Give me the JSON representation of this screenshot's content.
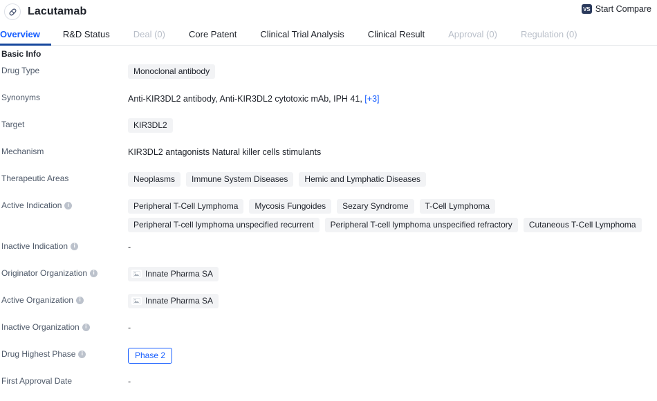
{
  "header": {
    "drug_name": "Lacutamab",
    "drug_icon": "capsule-pill-icon",
    "compare_label": "Start Compare",
    "compare_badge": "VS"
  },
  "tabs": [
    {
      "label": "Overview",
      "state": "active"
    },
    {
      "label": "R&D Status",
      "state": "normal"
    },
    {
      "label": "Deal (0)",
      "state": "disabled"
    },
    {
      "label": "Core Patent",
      "state": "normal"
    },
    {
      "label": "Clinical Trial Analysis",
      "state": "normal"
    },
    {
      "label": "Clinical Result",
      "state": "normal"
    },
    {
      "label": "Approval (0)",
      "state": "disabled"
    },
    {
      "label": "Regulation (0)",
      "state": "disabled"
    }
  ],
  "section": {
    "title": "Basic Info"
  },
  "fields": {
    "drug_type": {
      "label": "Drug Type",
      "tags": [
        "Monoclonal antibody"
      ]
    },
    "synonyms": {
      "label": "Synonyms",
      "text": "Anti-KIR3DL2 antibody,  Anti-KIR3DL2 cytotoxic mAb,  IPH 41,",
      "more": "[+3]"
    },
    "target": {
      "label": "Target",
      "tags": [
        "KIR3DL2"
      ]
    },
    "mechanism": {
      "label": "Mechanism",
      "text": "KIR3DL2 antagonists  Natural killer cells stimulants"
    },
    "therapeutic_areas": {
      "label": "Therapeutic Areas",
      "tags": [
        "Neoplasms",
        "Immune System Diseases",
        "Hemic and Lymphatic Diseases"
      ]
    },
    "active_indication": {
      "label": "Active Indication",
      "has_info": true,
      "tags": [
        "Peripheral T-Cell Lymphoma",
        "Mycosis Fungoides",
        "Sezary Syndrome",
        "T-Cell Lymphoma",
        "Peripheral T-cell lymphoma unspecified recurrent",
        "Peripheral T-cell lymphoma unspecified refractory",
        "Cutaneous T-Cell Lymphoma"
      ]
    },
    "inactive_indication": {
      "label": "Inactive Indication",
      "has_info": true,
      "value": "-"
    },
    "originator_organization": {
      "label": "Originator Organization",
      "has_info": true,
      "orgs": [
        "Innate Pharma SA"
      ]
    },
    "active_organization": {
      "label": "Active Organization",
      "has_info": true,
      "orgs": [
        "Innate Pharma SA"
      ]
    },
    "inactive_organization": {
      "label": "Inactive Organization",
      "has_info": true,
      "value": "-"
    },
    "drug_highest_phase": {
      "label": "Drug Highest Phase",
      "has_info": true,
      "badge": "Phase 2"
    },
    "first_approval_date": {
      "label": "First Approval Date",
      "value": "-"
    }
  },
  "colors": {
    "accent": "#165dff",
    "tab_underline": "#16479d",
    "tag_bg": "#f2f3f5",
    "label": "#4e5969",
    "text": "#1d2129",
    "vs_badge": "#2b3a5c"
  }
}
